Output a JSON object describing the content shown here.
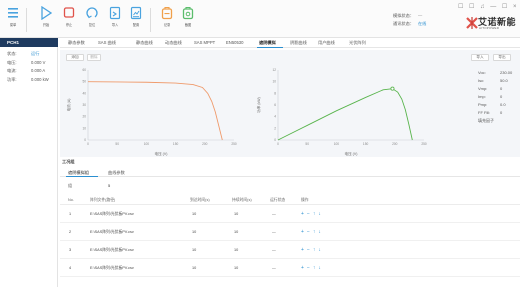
{
  "toolbar": {
    "buttons": [
      {
        "label": "菜单",
        "icon": "menu-icon"
      },
      {
        "label": "开始",
        "icon": "play-icon"
      },
      {
        "label": "停止",
        "icon": "stop-icon"
      },
      {
        "label": "复位",
        "icon": "reset-icon"
      },
      {
        "label": "导入",
        "icon": "import-icon"
      },
      {
        "label": "配置",
        "icon": "config-icon"
      },
      {
        "label": "记录",
        "icon": "record-icon"
      },
      {
        "label": "截图",
        "icon": "screenshot-icon"
      }
    ],
    "status": [
      {
        "label": "模拟状态：",
        "value": "—"
      },
      {
        "label": "通讯状态：",
        "value": "在线"
      }
    ],
    "window_controls": "☐ ☐ ♫ — ☐ ×"
  },
  "brand": {
    "name": "艾诺新能",
    "subtitle": "AITOPOWER"
  },
  "channel": {
    "title": "PCH1",
    "rows": [
      {
        "key": "状态:",
        "value": "运行"
      },
      {
        "key": "电压:",
        "value": "0.000 V"
      },
      {
        "key": "电流:",
        "value": "0.000 A"
      },
      {
        "key": "功率:",
        "value": "0.000 kW"
      }
    ]
  },
  "tabs": [
    "静态参数",
    "SAS 曲线",
    "静态曲线",
    "动态曲线",
    "SAS MPPT",
    "EN50530",
    "遮阴模拟",
    "阴影曲线",
    "用户曲线",
    "光伏阵列"
  ],
  "active_tab_index": 6,
  "chart_toolbar": {
    "add_label": "添加",
    "delete_label": "删除",
    "import_label": "导入",
    "export_label": "导出"
  },
  "params": [
    {
      "key": "Voc:",
      "value": "230.00",
      "unit": "V"
    },
    {
      "key": "Isc:",
      "value": "50.0",
      "unit": "A"
    },
    {
      "key": "Vmp:",
      "value": "0",
      "unit": "V"
    },
    {
      "key": "Imp:",
      "value": "0",
      "unit": "A"
    },
    {
      "key": "Pmp:",
      "value": "0.0",
      "unit": "kW"
    },
    {
      "key": "FF Fill:",
      "value": "0",
      "unit": "%"
    },
    {
      "key": "填充因子",
      "value": "",
      "unit": ""
    }
  ],
  "chart_data": [
    {
      "type": "line",
      "xlabel": "电压 (V)",
      "ylabel": "电流 (A)",
      "xlim": [
        0,
        250
      ],
      "ylim": [
        0,
        60
      ],
      "x_ticks": [
        "0",
        "50",
        "100",
        "150",
        "200",
        "250"
      ],
      "y_ticks": [
        "0",
        "10",
        "20",
        "30",
        "40",
        "50",
        "60"
      ],
      "series": [
        {
          "color": "#ef9a6b",
          "x": [
            0,
            50,
            100,
            150,
            180,
            196,
            205,
            212,
            218,
            224,
            228,
            230
          ],
          "y": [
            50,
            49.8,
            49.5,
            48.8,
            47.5,
            45,
            40,
            33,
            24,
            12,
            4,
            0
          ]
        }
      ]
    },
    {
      "type": "line",
      "xlabel": "电压 (V)",
      "ylabel": "功率 (kW)",
      "xlim": [
        0,
        250
      ],
      "ylim": [
        0,
        12
      ],
      "x_ticks": [
        "0",
        "50",
        "100",
        "150",
        "200",
        "250"
      ],
      "y_ticks": [
        "0",
        "2",
        "4",
        "6",
        "8",
        "10",
        "12"
      ],
      "series": [
        {
          "color": "#58b44c",
          "x": [
            0,
            50,
            100,
            150,
            180,
            196,
            205,
            212,
            218,
            224,
            228,
            230
          ],
          "y": [
            0,
            2.5,
            5.0,
            7.3,
            8.6,
            8.8,
            8.2,
            7.0,
            5.2,
            2.7,
            0.9,
            0
          ]
        }
      ],
      "marker": {
        "x": 196,
        "y": 8.8
      }
    }
  ],
  "lower": {
    "section_title": "工况组",
    "sub_tabs": [
      "遮阴模拟组",
      "曲线参数"
    ],
    "qty_label": "组",
    "qty_value": "5",
    "columns": [
      "No.",
      "阵列文件(路径)",
      "到达时间(s)",
      "持续时间(s)",
      "运行状态",
      "操作"
    ],
    "rows": [
      {
        "no": "1",
        "file": "E:\\SAS阵列\\光伏板PV.csv",
        "arrive": "10",
        "hold": "10",
        "status": "—"
      },
      {
        "no": "2",
        "file": "E:\\SAS阵列\\光伏板PV.csv",
        "arrive": "10",
        "hold": "10",
        "status": "—"
      },
      {
        "no": "3",
        "file": "E:\\SAS阵列\\光伏板PV.csv",
        "arrive": "10",
        "hold": "10",
        "status": "—"
      },
      {
        "no": "4",
        "file": "E:\\SAS阵列\\光伏板PV.csv",
        "arrive": "10",
        "hold": "10",
        "status": "—"
      }
    ],
    "ops": [
      "+",
      "−",
      "↑",
      "↓"
    ]
  },
  "colors": {
    "accent": "#2a8fd0",
    "toolbar_icon": "#4aa3df",
    "stop_red": "#e0524a",
    "record_orange": "#f0a04b",
    "screenshot_green": "#5bbd6c",
    "channel_head": "#1e3a5f",
    "iv_curve": "#ef9a6b",
    "pv_curve": "#58b44c"
  }
}
